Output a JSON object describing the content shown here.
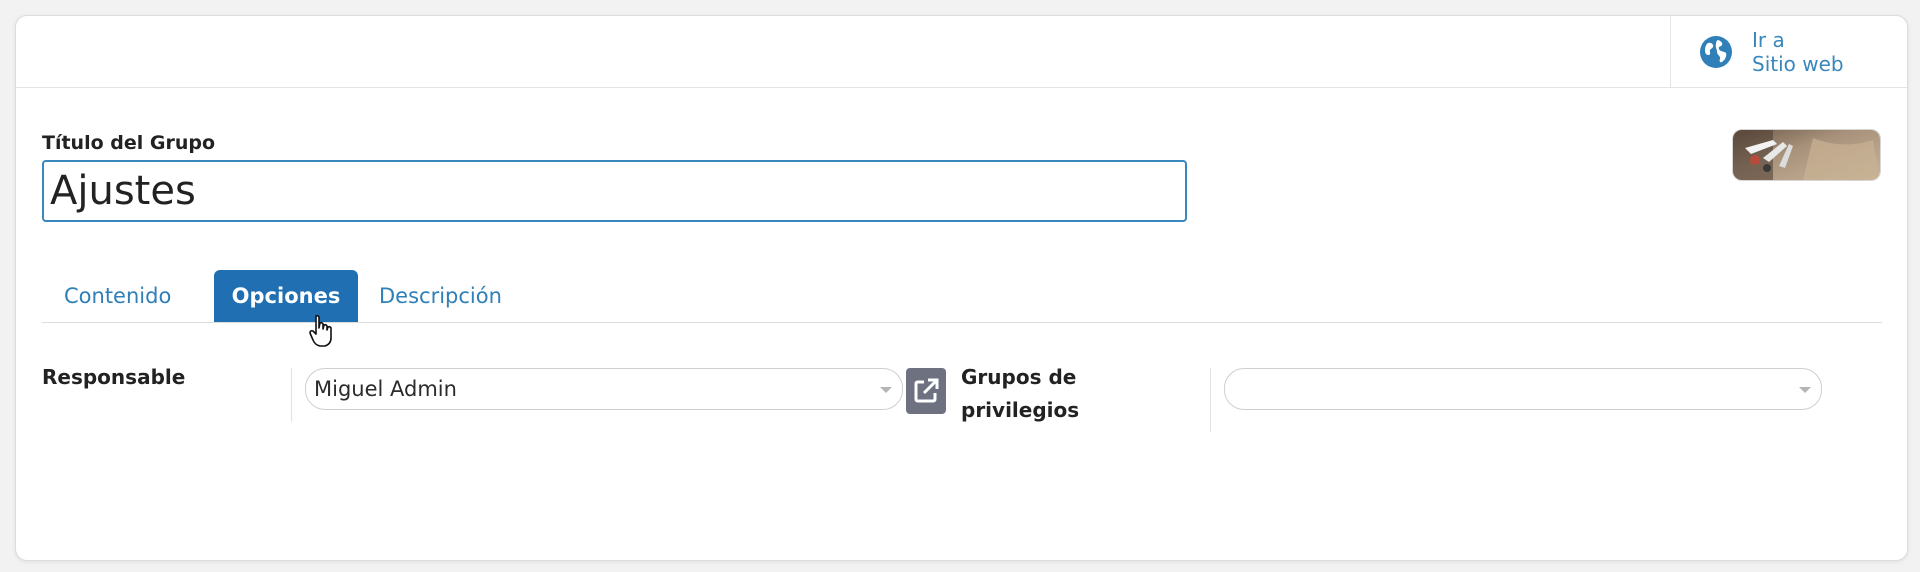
{
  "smart_button": {
    "line1": "Ir a",
    "line2": "Sitio web",
    "icon": "globe-icon"
  },
  "form": {
    "title_label": "Título del Grupo",
    "title_value": "Ajustes"
  },
  "tabs": [
    {
      "label": "Contenido",
      "active": false
    },
    {
      "label": "Opciones",
      "active": true
    },
    {
      "label": "Descripción",
      "active": false
    }
  ],
  "options": {
    "responsible_label": "Responsable",
    "responsible_value": "Miguel Admin",
    "groups_label_line1": "Grupos de",
    "groups_label_line2": "privilegios",
    "groups_value": ""
  },
  "colors": {
    "accent": "#1f6fb2",
    "link": "#2f7fb8",
    "external_button": "#6e7280"
  }
}
